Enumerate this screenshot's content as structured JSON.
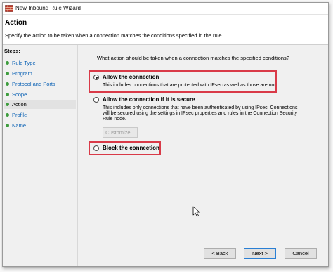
{
  "window": {
    "title": "New Inbound Rule Wizard",
    "icon": "firewall-icon"
  },
  "header": {
    "title": "Action",
    "subtitle": "Specify the action to be taken when a connection matches the conditions specified in the rule."
  },
  "steps": {
    "header": "Steps:",
    "items": [
      {
        "label": "Rule Type",
        "active": false
      },
      {
        "label": "Program",
        "active": false
      },
      {
        "label": "Protocol and Ports",
        "active": false
      },
      {
        "label": "Scope",
        "active": false
      },
      {
        "label": "Action",
        "active": true
      },
      {
        "label": "Profile",
        "active": false
      },
      {
        "label": "Name",
        "active": false
      }
    ]
  },
  "main": {
    "question": "What action should be taken when a connection matches the specified conditions?",
    "options": [
      {
        "label": "Allow the connection",
        "description": "This includes connections that are protected with IPsec as well as those are not.",
        "checked": true
      },
      {
        "label": "Allow the connection if it is secure",
        "description_lines": [
          "This includes only connections that have been authenticated by using IPsec.  Connections",
          "will be secured using the settings in IPsec properties and rules in the Connection Security",
          "Rule node."
        ],
        "checked": false
      },
      {
        "label": "Block the connection",
        "checked": false
      }
    ],
    "customize_label": "Customize..."
  },
  "footer": {
    "back_label": "< Back",
    "next_label": "Next >",
    "cancel_label": "Cancel"
  },
  "colors": {
    "highlight": "#d93a48",
    "step_link": "#0b62b5",
    "step_dot": "#3d9c3d"
  }
}
